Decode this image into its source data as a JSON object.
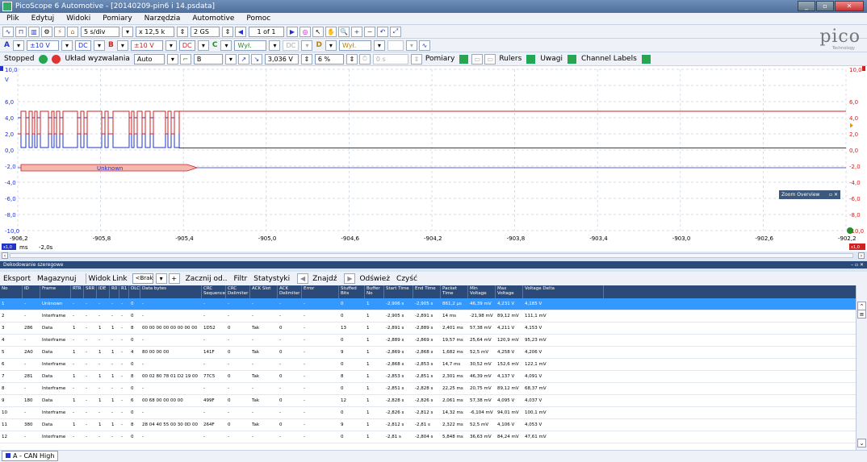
{
  "window": {
    "title": "PicoScope 6 Automotive - [20140209-pin6 i 14.psdata]"
  },
  "menu": [
    "Plik",
    "Edytuj",
    "Widoki",
    "Pomiary",
    "Narzędzia",
    "Automotive",
    "Pomoc"
  ],
  "toolbar1": {
    "timebase": "5 s/div",
    "samples": "x 12,5 k",
    "collection": "2 GS",
    "buffer": "1 of 1"
  },
  "toolbar2": {
    "chA_label": "A",
    "chA_range": "±10 V",
    "chA_coupling": "DC",
    "chB_label": "B",
    "chB_range": "±10 V",
    "chB_coupling": "DC",
    "chC_label": "C",
    "chC_range": "Wył.",
    "chC_coupling": "DC",
    "chD_label": "D",
    "chD_range": "Wył.",
    "chD_coupling": ""
  },
  "toolbar3": {
    "status": "Stopped",
    "trigger_label": "Układ wyzwalania",
    "trigger_mode": "Auto",
    "trigger_source": "B",
    "trigger_level": "3,036 V",
    "pretrigger": "6 %",
    "extra_field": "0 s",
    "pomiary": "Pomiary",
    "rulers": "Rulers",
    "uwagi": "Uwagi",
    "channel_labels": "Channel Labels"
  },
  "logo": {
    "text": "pico",
    "sub": "Technology"
  },
  "scope": {
    "y_left": [
      "10,0",
      "V",
      "6,0",
      "4,0",
      "2,0",
      "0,0",
      "-2,0",
      "-4,0",
      "-6,0",
      "-8,0",
      "-10,0"
    ],
    "y_right": [
      "10,0",
      "6,0",
      "4,0",
      "2,0",
      "0,0",
      "-2,0",
      "-4,0",
      "-6,0",
      "-8,0",
      "-10,0"
    ],
    "x_ticks": [
      "-906,2",
      "-905,8",
      "-905,4",
      "-905,0",
      "-904,6",
      "-904,2",
      "-903,8",
      "-903,4",
      "-903,0",
      "-902,6",
      "-902,2"
    ],
    "x_unit": "ms",
    "x_offset": "-2,0s",
    "x_badge_left": "x1,0",
    "x_badge_right": "x1,0",
    "decode_label": "Unknown",
    "zoom_overview": "Zoom Overview",
    "colors": {
      "chA": "#2233cc",
      "chB": "#d02020",
      "grid": "#c8d0dc"
    }
  },
  "decoder": {
    "panel_title": "Dekodowanie szeregowe",
    "toolbar": [
      "Eksport",
      "Magazynuj",
      "Widok",
      "Link",
      "<Brak>",
      "Zacznij od..",
      "Filtr",
      "Statystyki",
      "Znajdź",
      "Odśwież",
      "Czyść"
    ],
    "columns": [
      "No",
      "ID",
      "Frame",
      "RTR",
      "SRR",
      "IDE",
      "R0",
      "R1",
      "DLC",
      "Data bytes",
      "CRC Sequence",
      "CRC Delimiter",
      "ACK Slot",
      "ACK Delimiter",
      "Error",
      "Stuffed Bits",
      "Buffer No",
      "Start Time",
      "End Time",
      "Packet Time",
      "Min Voltage",
      "Max Voltage",
      "Voltage Delta"
    ],
    "rows": [
      [
        "1",
        "-",
        "Unknown",
        "-",
        "-",
        "-",
        "-",
        "-",
        "0",
        "-",
        "-",
        "-",
        "-",
        "-",
        "-",
        "0",
        "1",
        "-2,906 s",
        "-2,905 s",
        "861,2 µs",
        "46,39 mV",
        "4,231 V",
        "4,185 V"
      ],
      [
        "2",
        "-",
        "Interframe",
        "-",
        "-",
        "-",
        "-",
        "-",
        "0",
        "-",
        "-",
        "-",
        "-",
        "-",
        "-",
        "0",
        "1",
        "-2,905 s",
        "-2,891 s",
        "14 ms",
        "-21,98 mV",
        "89,12 mV",
        "111,1 mV"
      ],
      [
        "3",
        "286",
        "Data",
        "1",
        "-",
        "1",
        "1",
        "-",
        "8",
        "00 00 00 00 00 00 00 00",
        "1D52",
        "0",
        "Tak",
        "0",
        "-",
        "13",
        "1",
        "-2,891 s",
        "-2,889 s",
        "2,401 ms",
        "57,38 mV",
        "4,211 V",
        "4,153 V"
      ],
      [
        "4",
        "-",
        "Interframe",
        "-",
        "-",
        "-",
        "-",
        "-",
        "0",
        "-",
        "-",
        "-",
        "-",
        "-",
        "-",
        "0",
        "1",
        "-2,889 s",
        "-2,869 s",
        "19,57 ms",
        "25,64 mV",
        "120,9 mV",
        "95,23 mV"
      ],
      [
        "5",
        "2A0",
        "Data",
        "1",
        "-",
        "1",
        "1",
        "-",
        "4",
        "80 00 00 00",
        "141F",
        "0",
        "Tak",
        "0",
        "-",
        "9",
        "1",
        "-2,869 s",
        "-2,868 s",
        "1,682 ms",
        "52,5 mV",
        "4,258 V",
        "4,206 V"
      ],
      [
        "6",
        "-",
        "Interframe",
        "-",
        "-",
        "-",
        "-",
        "-",
        "0",
        "-",
        "-",
        "-",
        "-",
        "-",
        "-",
        "0",
        "1",
        "-2,868 s",
        "-2,853 s",
        "14,7 ms",
        "30,52 mV",
        "152,6 mV",
        "122,1 mV"
      ],
      [
        "7",
        "281",
        "Data",
        "1",
        "-",
        "1",
        "1",
        "-",
        "8",
        "00 02 80 78 01 D2 19 00",
        "77C5",
        "0",
        "Tak",
        "0",
        "-",
        "8",
        "1",
        "-2,853 s",
        "-2,851 s",
        "2,301 ms",
        "46,39 mV",
        "4,137 V",
        "4,091 V"
      ],
      [
        "8",
        "-",
        "Interframe",
        "-",
        "-",
        "-",
        "-",
        "-",
        "0",
        "-",
        "-",
        "-",
        "-",
        "-",
        "-",
        "0",
        "1",
        "-2,851 s",
        "-2,828 s",
        "22,25 ms",
        "20,75 mV",
        "89,12 mV",
        "68,37 mV"
      ],
      [
        "9",
        "180",
        "Data",
        "1",
        "-",
        "1",
        "1",
        "-",
        "6",
        "00 68 00 00 00 00",
        "499F",
        "0",
        "Tak",
        "0",
        "-",
        "12",
        "1",
        "-2,828 s",
        "-2,826 s",
        "2,061 ms",
        "57,38 mV",
        "4,095 V",
        "4,037 V"
      ],
      [
        "10",
        "-",
        "Interframe",
        "-",
        "-",
        "-",
        "-",
        "-",
        "0",
        "-",
        "-",
        "-",
        "-",
        "-",
        "-",
        "0",
        "1",
        "-2,826 s",
        "-2,812 s",
        "14,32 ms",
        "-6,104 mV",
        "94,01 mV",
        "100,1 mV"
      ],
      [
        "11",
        "380",
        "Data",
        "1",
        "-",
        "1",
        "1",
        "-",
        "8",
        "28 04 40 55 00 30 0D 00",
        "264F",
        "0",
        "Tak",
        "0",
        "-",
        "9",
        "1",
        "-2,812 s",
        "-2,81 s",
        "2,322 ms",
        "52,5 mV",
        "4,106 V",
        "4,053 V"
      ],
      [
        "12",
        "-",
        "Interframe",
        "-",
        "-",
        "-",
        "-",
        "-",
        "0",
        "-",
        "-",
        "-",
        "-",
        "-",
        "-",
        "0",
        "1",
        "-2,81 s",
        "-2,804 s",
        "5,848 ms",
        "36,63 mV",
        "84,24 mV",
        "47,61 mV"
      ]
    ]
  },
  "bottom_tab": "A - CAN High"
}
